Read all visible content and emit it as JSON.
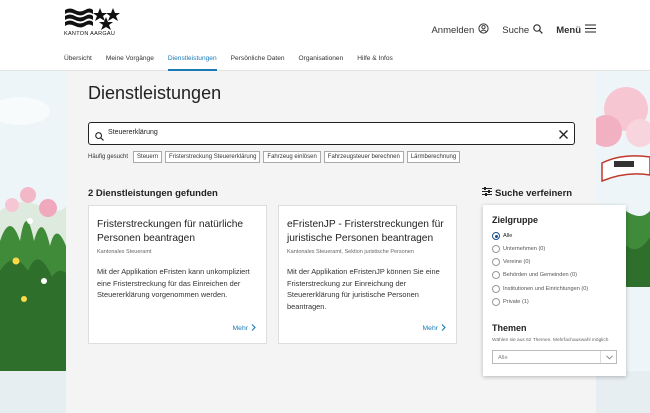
{
  "header": {
    "logo_text": "KANTON AARGAU",
    "login_label": "Anmelden",
    "search_label": "Suche",
    "menu_label": "Menü"
  },
  "nav": {
    "items": [
      "Übersicht",
      "Meine Vorgänge",
      "Dienstleistungen",
      "Persönliche Daten",
      "Organisationen",
      "Hilfe & Infos"
    ],
    "active": "Dienstleistungen"
  },
  "main": {
    "title": "Dienstleistungen",
    "search_value": "Steuererklärung",
    "frequent_label": "Häufig gesucht",
    "frequent_chips": [
      "Steuern",
      "Fristerstreckung Steuererklärung",
      "Fahrzeug einlösen",
      "Fahrzeugsteuer berechnen",
      "Lärmberechnung"
    ],
    "result_count": "2 Dienstleistungen gefunden",
    "refine_label": "Suche verfeinern"
  },
  "cards": [
    {
      "title": "Fristerstreckungen für natürliche Personen beantragen",
      "org": "Kantonales Steueramt",
      "text": "Mit der Applikation eFristen kann unkompliziert eine Fristerstreckung für das Einreichen der Steuererklärung vorgenommen werden.",
      "more": "Mehr"
    },
    {
      "title": "eFristenJP - Fristerstreckungen für juristische Personen beantragen",
      "org": "Kantonales Steueramt, Sektion juristische Personen",
      "text": "Mit der Applikation eFristenJP können Sie eine Fristerstreckung zur Einreichung der Steuererklärung für juristische Personen beantragen.",
      "more": "Mehr"
    }
  ],
  "filter": {
    "group_heading": "Zielgruppe",
    "options": [
      "Alle",
      "Unternehmen (0)",
      "Vereine (0)",
      "Behörden und Gemeinden (0)",
      "Institutionen und Einrichtungen (0)",
      "Private (1)"
    ],
    "selected": "Alle",
    "themes_heading": "Themen",
    "themes_hint": "Wählen sie aus 62 Themen. Mehrfachauswahl möglich",
    "themes_value": "Alle"
  },
  "colors": {
    "accent": "#1a7ab8",
    "radio_selected": "#1a4f8b"
  }
}
